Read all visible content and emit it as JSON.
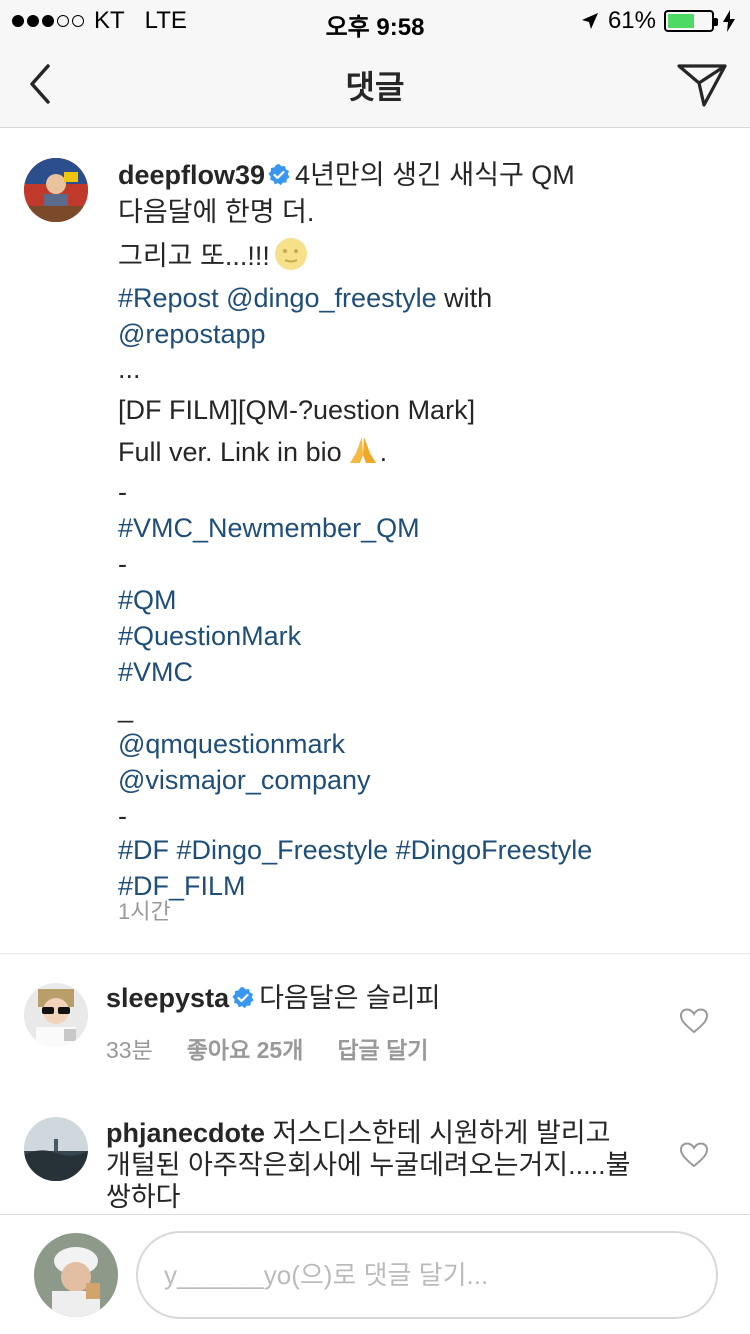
{
  "status_bar": {
    "carrier": "KT",
    "network": "LTE",
    "time": "오후 9:58",
    "battery_percent": "61%",
    "battery_level": 0.61
  },
  "header": {
    "title": "댓글"
  },
  "caption": {
    "username": "deepflow39",
    "lines": [
      [
        "4년만의 생긴 새식구 QM"
      ],
      [
        "다음달에 한명 더."
      ],
      [
        "그리고 또...!!!"
      ],
      [
        "#Repost @dingo_freestyle",
        " with"
      ],
      [
        "@repostapp"
      ],
      [
        "..."
      ],
      [
        "[DF FILM][QM-?uestion Mark]"
      ],
      [
        "Full ver. Link in bio",
        "."
      ],
      [
        "-"
      ],
      [
        "#VMC_Newmember_QM"
      ],
      [
        "-"
      ],
      [
        "#QM"
      ],
      [
        "#QuestionMark"
      ],
      [
        "#VMC"
      ],
      [
        "_"
      ],
      [
        "@qmquestionmark"
      ],
      [
        "@vismajor_company"
      ],
      [
        "-"
      ],
      [
        "#DF #Dingo_Freestyle #DingoFreestyle"
      ],
      [
        "#DF_FILM"
      ]
    ],
    "time": "1시간"
  },
  "comments": [
    {
      "username": "sleepysta",
      "verified": true,
      "text_lines": [
        "다음달은 슬리피"
      ],
      "time": "33분",
      "likes": "좋아요 25개",
      "reply": "답글 달기"
    },
    {
      "username": "phjanecdote",
      "verified": false,
      "text_lines": [
        "저스디스한테 시원하게 발리고",
        "개털된 아주작은회사에 누굴데려오는거지.....불",
        "쌍하다"
      ]
    }
  ],
  "composer": {
    "placeholder": "y______yo(으)로 댓글 달기..."
  },
  "colors": {
    "hashtag": "#1f4e79",
    "verified": "#3897f0",
    "battery": "#4cd964",
    "meta": "#999999"
  }
}
